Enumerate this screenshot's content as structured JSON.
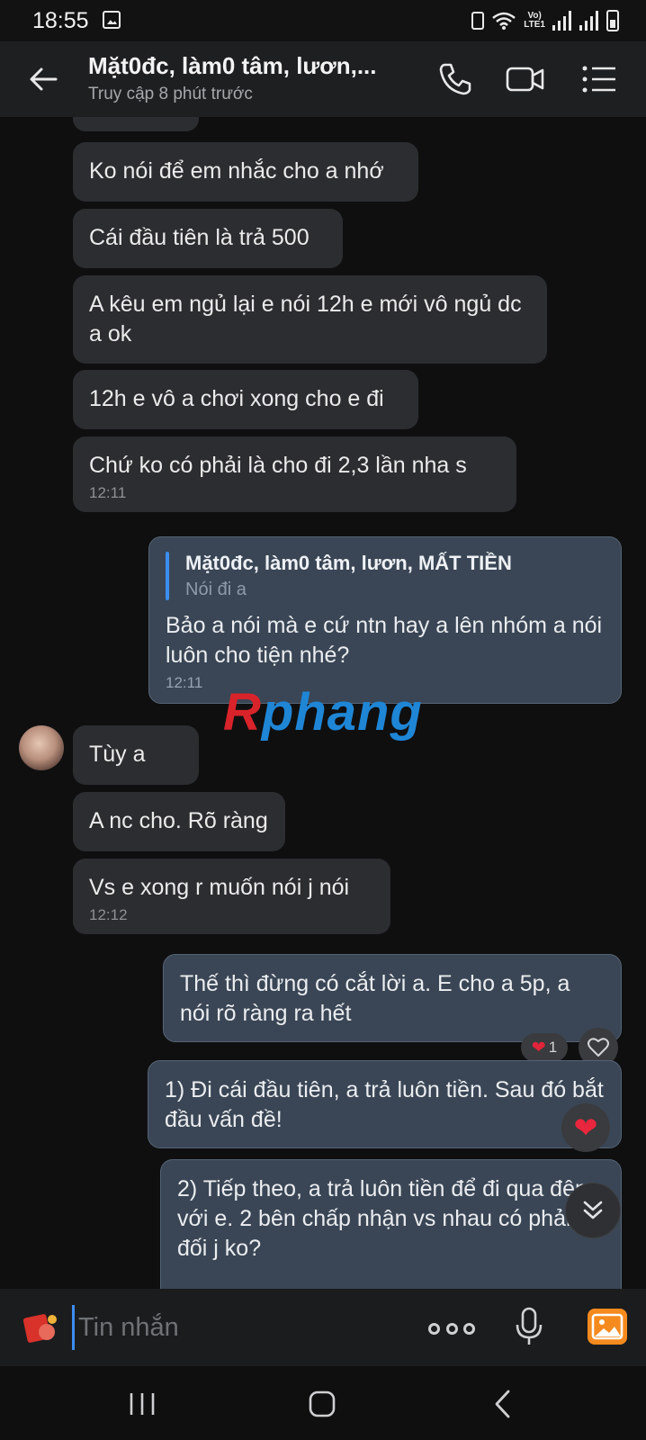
{
  "status_bar": {
    "time": "18:55",
    "lte_label_top": "Vo)",
    "lte_label_bottom": "LTE1"
  },
  "header": {
    "title": "Mặt0đc, làm0 tâm, lươn,...",
    "subtitle": "Truy cập 8 phút trước"
  },
  "messages": [
    {
      "text": "Ko nói để em nhắc cho a nhớ"
    },
    {
      "text": "Cái đầu tiên là trả 500"
    },
    {
      "text": "A kêu em ngủ lại e nói 12h e mới vô ngủ dc a ok"
    },
    {
      "text": "12h e vô a chơi xong cho e đi"
    },
    {
      "text": "Chứ ko có phải là cho đi 2,3 lần nha s",
      "time": "12:11"
    },
    {
      "quote_name": "Mặt0đc, làm0 tâm, lươn, MẤT TIỀN",
      "quote_text": "Nói đi a",
      "text": "Bảo a nói mà e cứ ntn hay a lên nhóm a nói luôn cho tiện nhé?",
      "time": "12:11"
    },
    {
      "text": "Tùy a"
    },
    {
      "text": "A nc cho. Rõ ràng"
    },
    {
      "text": "Vs e xong r muốn nói j nói",
      "time": "12:12"
    },
    {
      "text": "Thế thì đừng có cắt lời a. E cho a 5p, a nói rõ ràng ra hết"
    },
    {
      "text": "1) Đi cái đầu tiên, a trả luôn tiền. Sau đó bắt đầu vấn đề!"
    },
    {
      "text": "2) Tiếp theo, a trả luôn tiền để đi qua đêm với e. 2 bên chấp nhận vs nhau có phản đối j ko?"
    }
  ],
  "reaction": {
    "count": "1",
    "icon": "heart-icon",
    "color": "#e0243a"
  },
  "watermark": {
    "first": "R",
    "rest": "phang"
  },
  "composer": {
    "placeholder": "Tin nhắn"
  },
  "colors": {
    "incoming_bubble": "#2c2d30",
    "outgoing_bubble": "#3a4655",
    "accent": "#3c8df0",
    "gallery": "#f58a1f"
  }
}
